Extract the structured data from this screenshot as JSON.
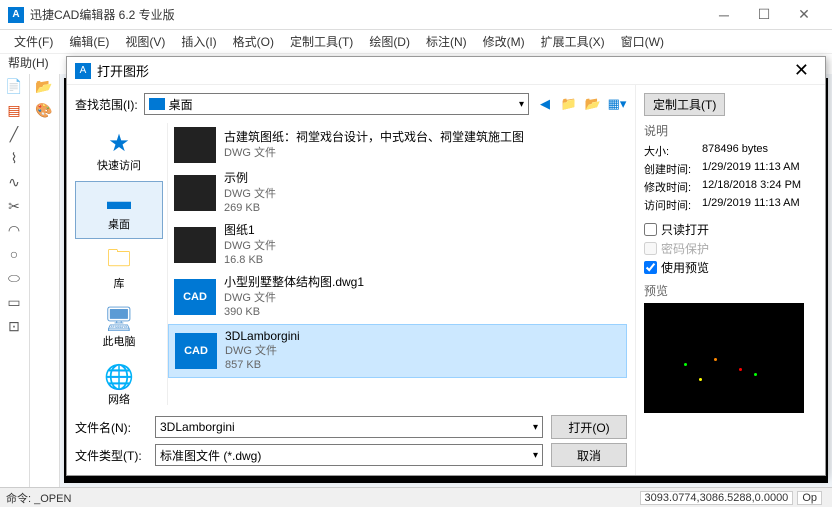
{
  "app": {
    "title": "迅捷CAD编辑器 6.2 专业版",
    "logo_text": "A"
  },
  "menus": [
    "文件(F)",
    "编辑(E)",
    "视图(V)",
    "插入(I)",
    "格式(O)",
    "定制工具(T)",
    "绘图(D)",
    "标注(N)",
    "修改(M)",
    "扩展工具(X)",
    "窗口(W)"
  ],
  "help_menu": "帮助(H)",
  "dialog": {
    "title": "打开图形",
    "lookin_label": "查找范围(I):",
    "lookin_value": "桌面",
    "places": [
      {
        "label": "快速访问",
        "icon": "★",
        "color": "#0078d4"
      },
      {
        "label": "桌面",
        "icon": "▬",
        "color": "#0078d4",
        "selected": true
      },
      {
        "label": "库",
        "icon": "🗀",
        "color": "#ffb900"
      },
      {
        "label": "此电脑",
        "icon": "🖥",
        "color": "#5b9bd5"
      },
      {
        "label": "网络",
        "icon": "🌐",
        "color": "#0078d4"
      }
    ],
    "files": [
      {
        "name": "古建筑图纸：祠堂戏台设计，中式戏台、祠堂建筑施工图",
        "type": "DWG 文件",
        "size": "",
        "thumb": "dark"
      },
      {
        "name": "示例",
        "type": "DWG 文件",
        "size": "269 KB",
        "thumb": "dark"
      },
      {
        "name": "图纸1",
        "type": "DWG 文件",
        "size": "16.8 KB",
        "thumb": "dark"
      },
      {
        "name": "小型别墅整体结构图.dwg1",
        "type": "DWG 文件",
        "size": "390 KB",
        "thumb": "cad"
      },
      {
        "name": "3DLamborgini",
        "type": "DWG 文件",
        "size": "857 KB",
        "thumb": "cad",
        "selected": true
      }
    ],
    "filename_label": "文件名(N):",
    "filename_value": "3DLamborgini",
    "filetype_label": "文件类型(T):",
    "filetype_value": "标准图文件 (*.dwg)",
    "open_btn": "打开(O)",
    "cancel_btn": "取消",
    "side": {
      "tools_btn": "定制工具(T)",
      "desc_label": "说明",
      "props": [
        {
          "k": "大小:",
          "v": "878496 bytes"
        },
        {
          "k": "创建时间:",
          "v": "1/29/2019 11:13 AM"
        },
        {
          "k": "修改时间:",
          "v": "12/18/2018 3:24 PM"
        },
        {
          "k": "访问时间:",
          "v": "1/29/2019 11:13 AM"
        }
      ],
      "readonly": "只读打开",
      "password": "密码保护",
      "usepreview": "使用预览",
      "preview_label": "预览"
    }
  },
  "status": {
    "cmd": "命令: _OPEN",
    "coords": "3093.0774,3086.5288,0.0000",
    "op": "Op"
  }
}
